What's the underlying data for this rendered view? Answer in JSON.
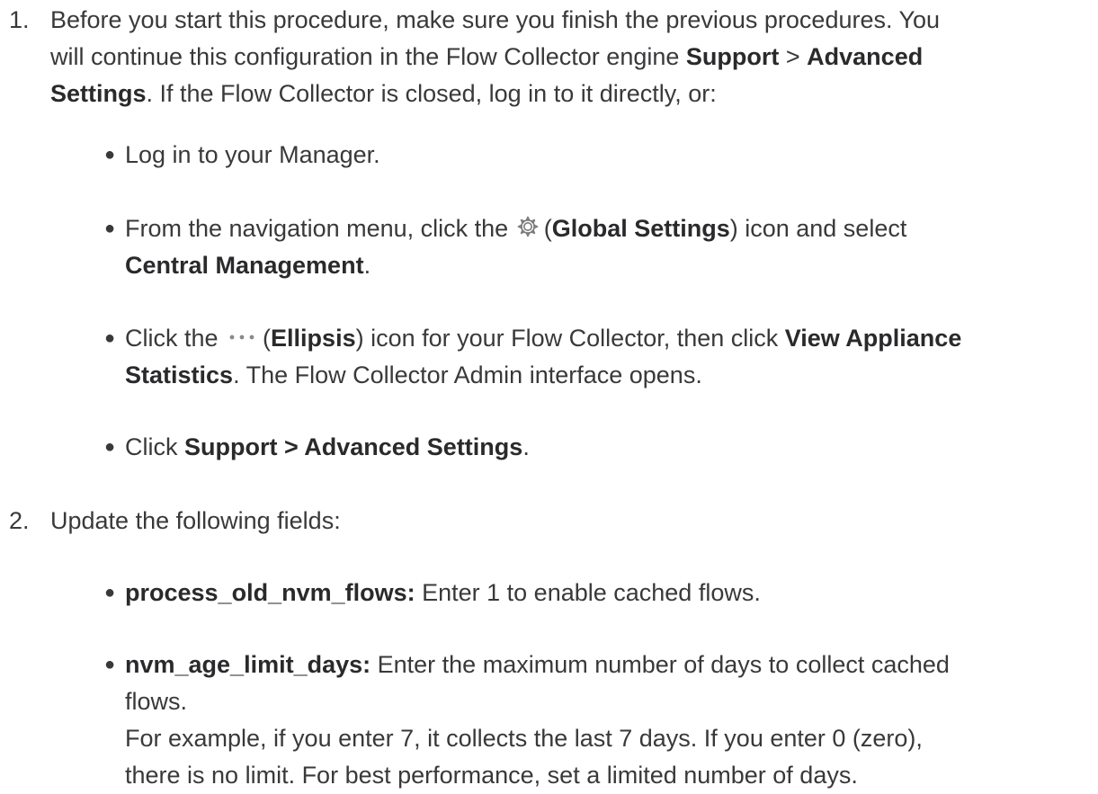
{
  "step1": {
    "number": "1.",
    "line1": "Before you start this procedure, make sure you finish the previous procedures. You",
    "line2_pre": "will continue this configuration in the Flow Collector engine ",
    "line2_b1": "Support",
    "line2_mid": " > ",
    "line2_b2": "Advanced",
    "line3_b": "Settings",
    "line3_post": ". If the Flow Collector is closed, log in to it directly, or:",
    "bullets": {
      "b1": "Log in to your Manager.",
      "b2_pre": "From the navigation menu, click the ",
      "b2_paren_open": "(",
      "b2_b1": "Global Settings",
      "b2_post": ") icon and select",
      "b2_b2": "Central Management",
      "b2_end": ".",
      "b3_pre": "Click the ",
      "b3_paren_open": "(",
      "b3_b1": "Ellipsis",
      "b3_post": ") icon for your Flow Collector, then click ",
      "b3_b2a": "View Appliance",
      "b3_b2b": "Statistics",
      "b3_end": ". The Flow Collector Admin interface opens.",
      "b4_pre": "Click ",
      "b4_b": "Support > Advanced Settings",
      "b4_end": "."
    }
  },
  "step2": {
    "number": "2.",
    "text": "Update the following fields:",
    "bullets": {
      "f1_name": "process_old_nvm_flows:",
      "f1_desc": " Enter 1 to enable cached flows.",
      "f2_name": "nvm_age_limit_days:",
      "f2_desc": " Enter the maximum number of days to collect cached",
      "f2_desc2": "flows.",
      "f2_note1": "For example, if you enter 7, it collects the last 7 days. If you enter 0 (zero),",
      "f2_note2": "there is no limit. For best performance, set a limited number of days."
    }
  },
  "colors": {
    "text": "#39393b",
    "bold": "#2a2a2c",
    "icon": "#7a7a7c"
  },
  "icons": {
    "global_settings": "gear-icon",
    "ellipsis": "ellipsis-icon",
    "bullet": "bullet-dot"
  }
}
